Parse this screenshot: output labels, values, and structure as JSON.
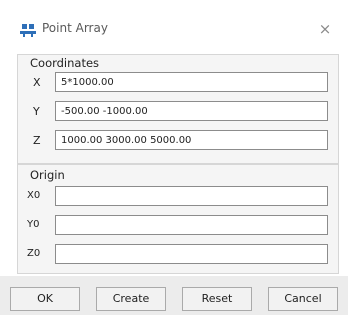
{
  "window": {
    "title": "Point Array",
    "close_glyph": "×",
    "app_icon": "point-array-icon",
    "close_icon": "close-icon"
  },
  "coordinates": {
    "label": "Coordinates",
    "rows": [
      {
        "label": "X",
        "value": "5*1000.00"
      },
      {
        "label": "Y",
        "value": "-500.00 -1000.00"
      },
      {
        "label": "Z",
        "value": "1000.00 3000.00 5000.00"
      }
    ]
  },
  "origin": {
    "label": "Origin",
    "rows": [
      {
        "label": "X0",
        "value": ""
      },
      {
        "label": "Y0",
        "value": ""
      },
      {
        "label": "Z0",
        "value": ""
      }
    ]
  },
  "buttons": {
    "ok": "OK",
    "create": "Create",
    "reset": "Reset",
    "cancel": "Cancel"
  },
  "colors": {
    "app_icon_blue": "#2e6fb8",
    "group_bg": "#f5f5f5",
    "button_bar_bg": "#ececec"
  }
}
